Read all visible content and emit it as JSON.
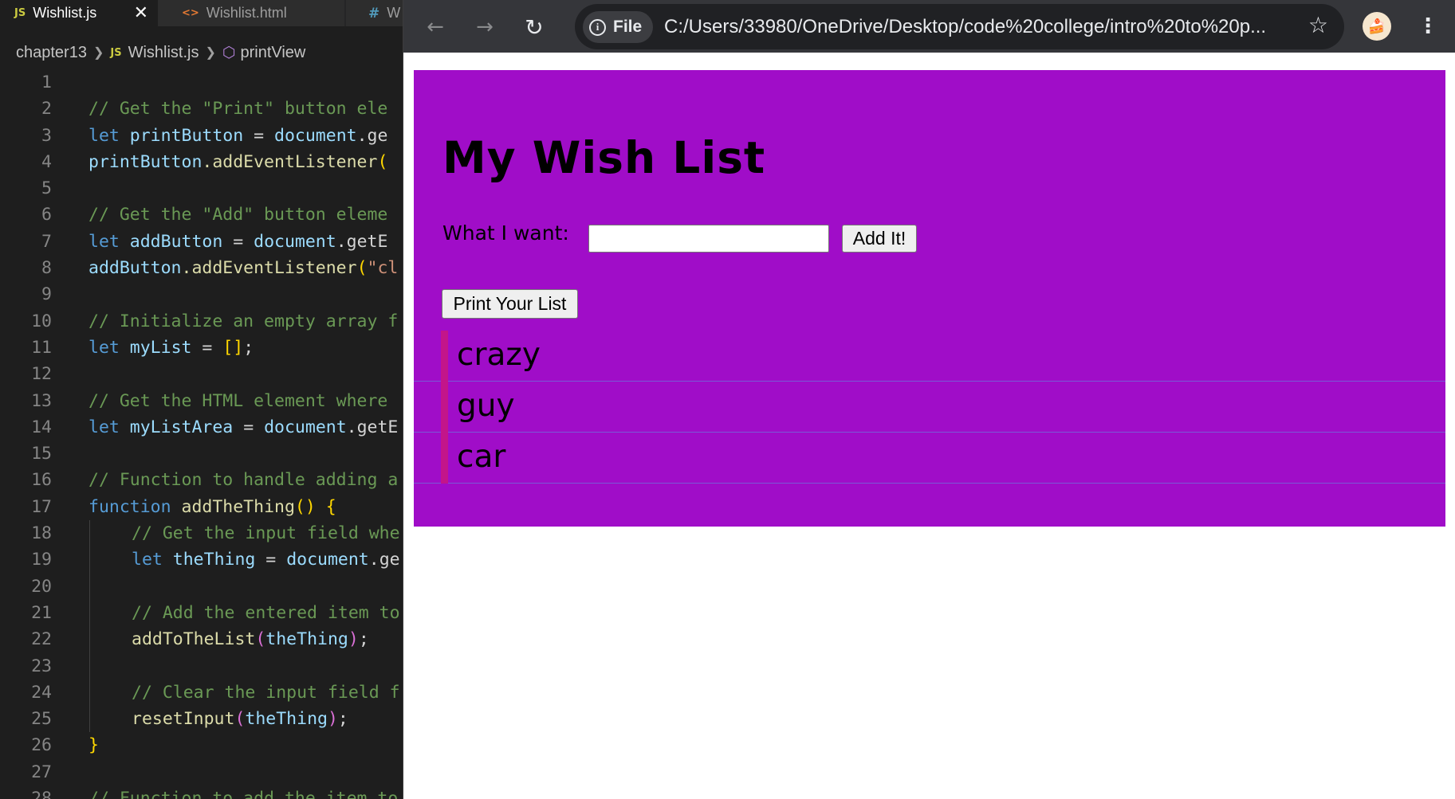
{
  "editor": {
    "tabs": [
      {
        "icon": "JS",
        "label": "Wishlist.js",
        "close": "✕"
      },
      {
        "icon": "<>",
        "label": "Wishlist.html"
      },
      {
        "icon": "#",
        "label": "W"
      }
    ],
    "breadcrumb": {
      "folder": "chapter13",
      "file_icon": "JS",
      "file": "Wishlist.js",
      "symbol": "printView"
    },
    "line_numbers": [
      "1",
      "2",
      "3",
      "4",
      "5",
      "6",
      "7",
      "8",
      "9",
      "10",
      "11",
      "12",
      "13",
      "14",
      "15",
      "16",
      "17",
      "18",
      "19",
      "20",
      "21",
      "22",
      "23",
      "24",
      "25",
      "26",
      "27",
      "28"
    ],
    "code": {
      "l2": "// Get the \"Print\" button ele",
      "l3": {
        "kw": "let",
        "var": "printButton",
        "op": " = ",
        "obj": "document",
        "rest": ".ge"
      },
      "l4": {
        "obj": "printButton",
        "fn": ".addEventListener",
        "b": "("
      },
      "l6": "// Get the \"Add\" button eleme",
      "l7": {
        "kw": "let",
        "var": "addButton",
        "op": " = ",
        "obj": "document",
        "rest": ".getE"
      },
      "l8": {
        "obj": "addButton",
        "fn": ".addEventListener",
        "b": "(",
        "str": "\"cl"
      },
      "l10": "// Initialize an empty array f",
      "l11": {
        "kw": "let",
        "var": "myList",
        "op": " = ",
        "b": "[]",
        "end": ";"
      },
      "l13": "// Get the HTML element where",
      "l14": {
        "kw": "let",
        "var": "myListArea",
        "op": " = ",
        "obj": "document",
        "rest": ".getE"
      },
      "l16": "// Function to handle adding a",
      "l17": {
        "kw": "function",
        "fn": "addTheThing",
        "b": "()",
        "b2": "{"
      },
      "l18": "// Get the input field whe",
      "l19": {
        "kw": "let",
        "var": "theThing",
        "op": " = ",
        "obj": "document",
        "rest": ".ge"
      },
      "l21": "// Add the entered item to",
      "l22": {
        "fn": "addToTheList",
        "b": "(",
        "arg": "theThing",
        "b_end": ")",
        "end": ";"
      },
      "l24": "// Clear the input field f",
      "l25": {
        "fn": "resetInput",
        "b": "(",
        "arg": "theThing",
        "b_end": ")",
        "end": ";"
      },
      "l26": "}",
      "l28": "// Function to add the item to"
    }
  },
  "browser": {
    "nav": {
      "back": "←",
      "forward": "→",
      "reload": "↻"
    },
    "chip": {
      "icon": "i",
      "label": "File"
    },
    "url": "C:/Users/33980/OneDrive/Desktop/code%20college/intro%20to%20p...",
    "star": "☆",
    "avatar": "🍰",
    "menu": "⋮"
  },
  "page": {
    "title": "My Wish List",
    "want_label": "What I want:",
    "input_value": "",
    "add_button": "Add It!",
    "print_button": "Print Your List",
    "items": [
      "crazy",
      "guy",
      "car"
    ]
  },
  "colors": {
    "page_bg": "#a00dc8",
    "item_bar": "#c3158a",
    "item_divider": "#7a59d6",
    "editor_bg": "#1e1e1e",
    "browser_toolbar": "#35363a"
  }
}
